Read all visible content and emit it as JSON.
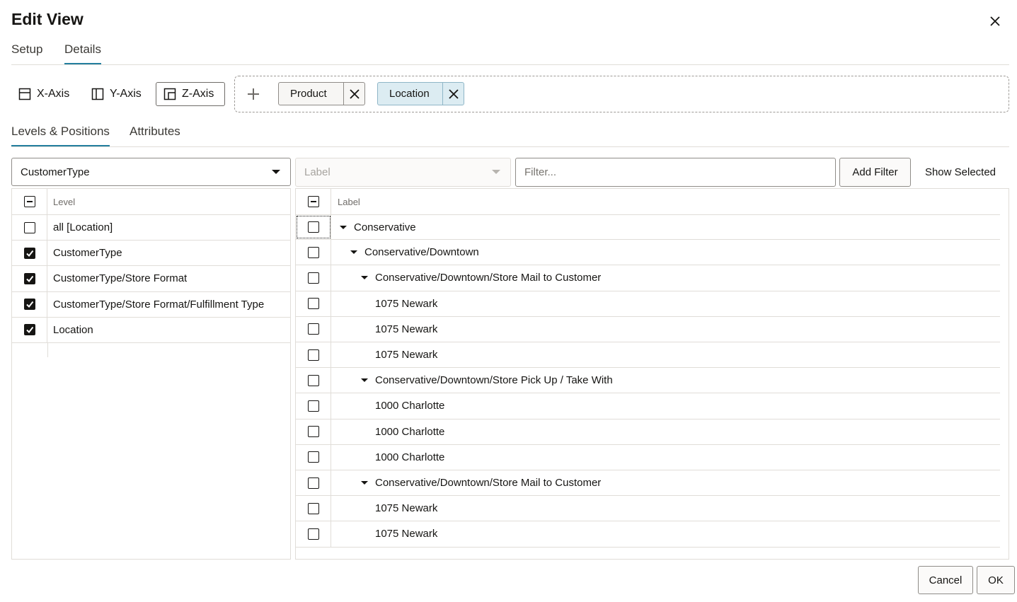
{
  "dialog": {
    "title": "Edit View",
    "close_icon": "close-icon"
  },
  "tabs": [
    "Setup",
    "Details"
  ],
  "active_tab": "Details",
  "axes": [
    {
      "label": "X-Axis",
      "icon": "x-axis-icon",
      "selected": false
    },
    {
      "label": "Y-Axis",
      "icon": "y-axis-icon",
      "selected": false
    },
    {
      "label": "Z-Axis",
      "icon": "z-axis-icon",
      "selected": true
    }
  ],
  "dimensions": [
    {
      "label": "Product",
      "active": false
    },
    {
      "label": "Location",
      "active": true
    }
  ],
  "sub_tabs": [
    "Levels & Positions",
    "Attributes"
  ],
  "active_sub_tab": "Levels & Positions",
  "level_select": {
    "value": "CustomerType"
  },
  "label_select": {
    "value": "Label",
    "disabled": true
  },
  "filter": {
    "placeholder": "Filter...",
    "value": ""
  },
  "add_filter_label": "Add Filter",
  "show_selected_label": "Show Selected",
  "levels_grid": {
    "header": "Level",
    "rows": [
      {
        "label": "all [Location]",
        "checked": false
      },
      {
        "label": "CustomerType",
        "checked": true
      },
      {
        "label": "CustomerType/Store Format",
        "checked": true
      },
      {
        "label": "CustomerType/Store Format/Fulfillment Type",
        "checked": true
      },
      {
        "label": "Location",
        "checked": true
      }
    ]
  },
  "positions_grid": {
    "header": "Label",
    "rows": [
      {
        "label": "Conservative",
        "depth": 0,
        "expandable": true,
        "checked": false
      },
      {
        "label": "Conservative/Downtown",
        "depth": 1,
        "expandable": true,
        "checked": false
      },
      {
        "label": "Conservative/Downtown/Store Mail to Customer",
        "depth": 2,
        "expandable": true,
        "checked": false
      },
      {
        "label": "1075 Newark",
        "depth": 3,
        "expandable": false,
        "checked": false
      },
      {
        "label": "1075 Newark",
        "depth": 3,
        "expandable": false,
        "checked": false
      },
      {
        "label": "1075 Newark",
        "depth": 3,
        "expandable": false,
        "checked": false
      },
      {
        "label": "Conservative/Downtown/Store Pick Up / Take With",
        "depth": 2,
        "expandable": true,
        "checked": false
      },
      {
        "label": "1000 Charlotte",
        "depth": 3,
        "expandable": false,
        "checked": false
      },
      {
        "label": "1000 Charlotte",
        "depth": 3,
        "expandable": false,
        "checked": false
      },
      {
        "label": "1000 Charlotte",
        "depth": 3,
        "expandable": false,
        "checked": false
      },
      {
        "label": "Conservative/Downtown/Store Mail to Customer",
        "depth": 2,
        "expandable": true,
        "checked": false
      },
      {
        "label": "1075 Newark",
        "depth": 3,
        "expandable": false,
        "checked": false
      },
      {
        "label": "1075 Newark",
        "depth": 3,
        "expandable": false,
        "checked": false
      }
    ]
  },
  "footer": {
    "cancel": "Cancel",
    "ok": "OK"
  },
  "colors": {
    "accent": "#227e9e",
    "active_chip": "#dcecf2",
    "border": "#8f8c88"
  }
}
